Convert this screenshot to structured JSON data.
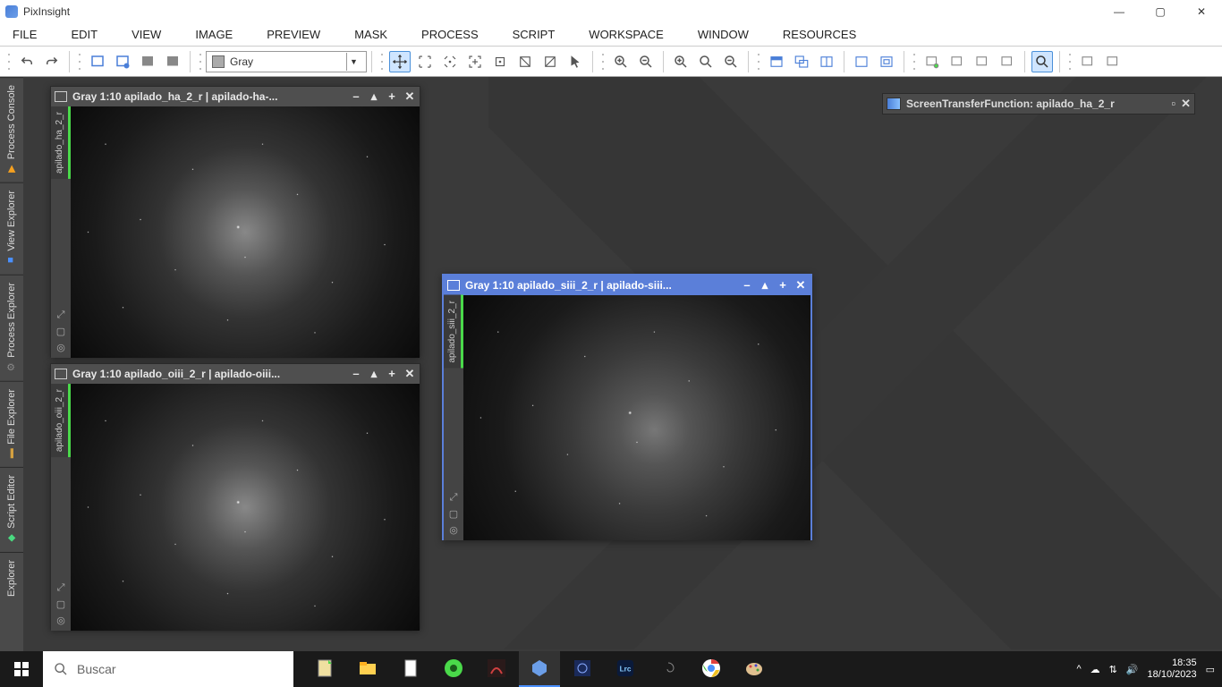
{
  "app": {
    "title": "PixInsight"
  },
  "menu": [
    "FILE",
    "EDIT",
    "VIEW",
    "IMAGE",
    "PREVIEW",
    "MASK",
    "PROCESS",
    "SCRIPT",
    "WORKSPACE",
    "WINDOW",
    "RESOURCES"
  ],
  "toolbar": {
    "colormode": "Gray"
  },
  "side_tabs": [
    "Process Console",
    "View Explorer",
    "Process Explorer",
    "File Explorer",
    "Script Editor",
    "Explorer"
  ],
  "windows": {
    "ha": {
      "title": "Gray 1:10 apilado_ha_2_r | apilado-ha-...",
      "vlabel": "apilado_ha_2_r"
    },
    "oiii": {
      "title": "Gray 1:10 apilado_oiii_2_r | apilado-oiii...",
      "vlabel": "apilado_oiii_2_r"
    },
    "siii": {
      "title": "Gray 1:10 apilado_siii_2_r | apilado-siii...",
      "vlabel": "apilado_siii_2_r"
    }
  },
  "stf": {
    "title": "ScreenTransferFunction: apilado_ha_2_r"
  },
  "taskbar": {
    "search_placeholder": "Buscar",
    "time": "18:35",
    "date": "18/10/2023"
  }
}
